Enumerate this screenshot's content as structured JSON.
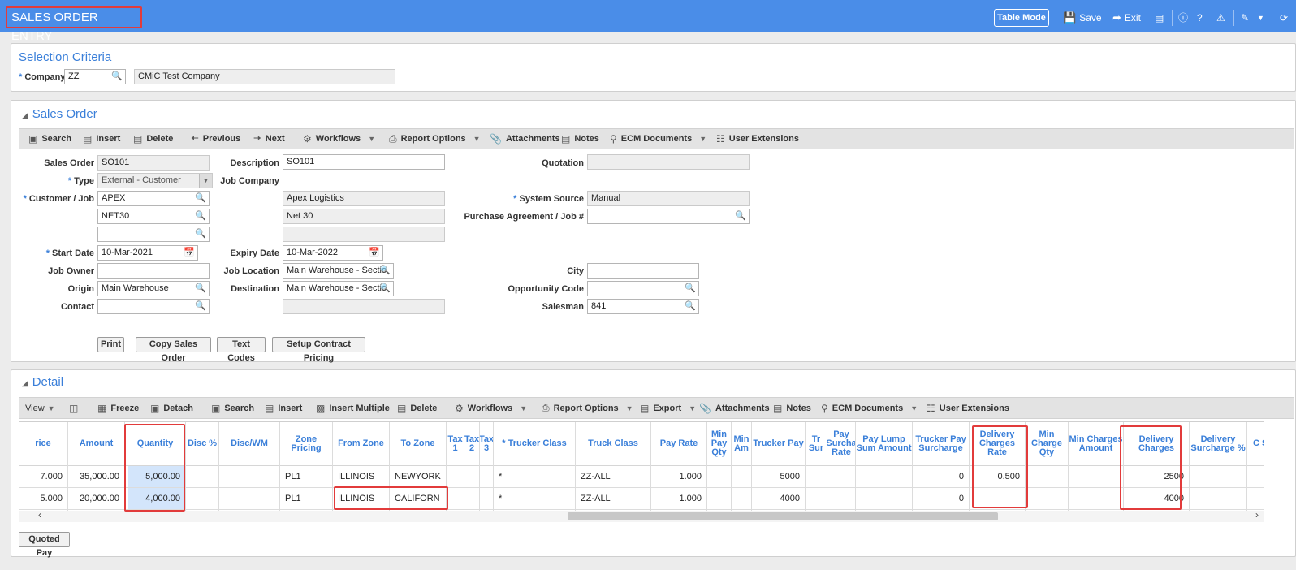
{
  "app": {
    "title": "SALES ORDER ENTRY"
  },
  "topbar": {
    "table_mode": "Table Mode",
    "save": "Save",
    "exit": "Exit"
  },
  "selection": {
    "title": "Selection Criteria",
    "company_label": "Company",
    "company_value": "ZZ",
    "company_name": "CMiC Test Company"
  },
  "sales_order": {
    "title": "Sales Order",
    "toolbar": [
      "Search",
      "Insert",
      "Delete",
      "Previous",
      "Next",
      "Workflows",
      "Report Options",
      "Attachments",
      "Notes",
      "ECM Documents",
      "User Extensions"
    ],
    "labels": {
      "sales_order": "Sales Order",
      "type": "Type",
      "customer_job": "Customer / Job",
      "start_date": "Start Date",
      "job_owner": "Job Owner",
      "origin": "Origin",
      "contact": "Contact",
      "description": "Description",
      "job_company": "Job Company",
      "expiry_date": "Expiry Date",
      "job_location": "Job Location",
      "destination": "Destination",
      "quotation": "Quotation",
      "system_source": "System Source",
      "purchase_agreement": "Purchase Agreement / Job #",
      "city": "City",
      "opportunity_code": "Opportunity Code",
      "salesman": "Salesman"
    },
    "values": {
      "sales_order": "SO101",
      "type": "External - Customer",
      "customer": "APEX",
      "customer_name": "Apex Logistics",
      "terms": "NET30",
      "terms_name": "Net 30",
      "start_date": "10-Mar-2021",
      "origin": "Main Warehouse",
      "description": "SO101",
      "expiry_date": "10-Mar-2022",
      "job_location": "Main Warehouse - Sectio",
      "destination": "Main Warehouse - Sectio",
      "system_source": "Manual",
      "salesman": "841"
    },
    "buttons": [
      "Print",
      "Copy Sales Order",
      "Text Codes",
      "Setup Contract Pricing"
    ]
  },
  "detail": {
    "title": "Detail",
    "view": "View",
    "toolbar": [
      "Freeze",
      "Detach",
      "Search",
      "Insert",
      "Insert Multiple",
      "Delete",
      "Workflows",
      "Report Options",
      "Export",
      "Attachments",
      "Notes",
      "ECM Documents",
      "User Extensions"
    ],
    "columns": [
      "rice",
      "Amount",
      "Quantity",
      "Disc %",
      "Disc/WM",
      "Zone Pricing",
      "From Zone",
      "To Zone",
      "Tax 1",
      "Tax 2",
      "Tax 3",
      "* Trucker Class",
      "Truck Class",
      "Pay Rate",
      "Min Pay Qty",
      "Min Am",
      "Trucker Pay",
      "Tr Sur",
      "Pay Surcha Rate",
      "Pay Lump Sum Amount",
      "Trucker Pay Surcharge",
      "Delivery Charges Rate",
      "Min Charge Qty",
      "Min Charges Amount",
      "Delivery Charges",
      "Delivery Surcharge %",
      "C Su"
    ],
    "rows": [
      [
        "7.000",
        "35,000.00",
        "5,000.00",
        "",
        "",
        "PL1",
        "ILLINOIS",
        "NEWYORK",
        "",
        "",
        "",
        "*",
        "ZZ-ALL",
        "1.000",
        "",
        "",
        "5000",
        "",
        "",
        "",
        "0",
        "0.500",
        "",
        "",
        "2500",
        "",
        ""
      ],
      [
        "5.000",
        "20,000.00",
        "4,000.00",
        "",
        "",
        "PL1",
        "ILLINOIS",
        "CALIFORN",
        "",
        "",
        "",
        "*",
        "ZZ-ALL",
        "1.000",
        "",
        "",
        "4000",
        "",
        "",
        "",
        "0",
        "",
        "",
        "",
        "4000",
        "",
        ""
      ]
    ],
    "quoted_pay": "Quoted Pay"
  }
}
